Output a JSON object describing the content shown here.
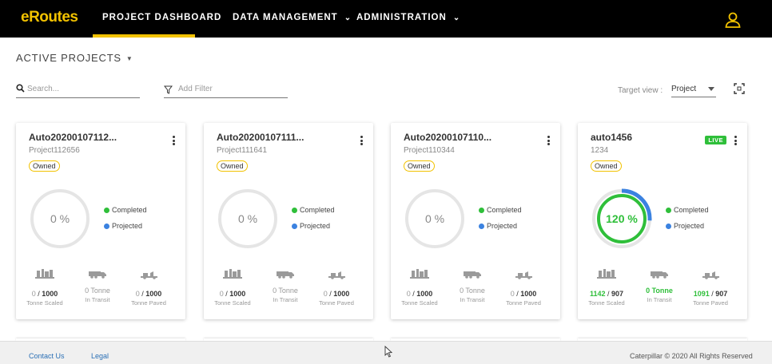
{
  "app": {
    "logo": "eRoutes"
  },
  "nav": {
    "items": [
      {
        "label": "PROJECT DASHBOARD",
        "active": true
      },
      {
        "label": "DATA MANAGEMENT",
        "dropdown": true
      },
      {
        "label": "ADMINISTRATION",
        "dropdown": true
      }
    ],
    "user_icon": "user-icon"
  },
  "toolbar": {
    "section_title": "ACTIVE PROJECTS",
    "search_placeholder": "Search...",
    "filter_placeholder": "Add Filter",
    "target_view_label": "Target view :",
    "target_view_value": "Project"
  },
  "projects": [
    {
      "title": "Auto20200107112...",
      "project_id": "Project112656",
      "owned_label": "Owned",
      "live": false,
      "percent": "0 %",
      "completion": 0,
      "legend_completed": "Completed",
      "legend_projected": "Projected",
      "scaled": {
        "value": "0",
        "total": "1000",
        "caption": "Tonne Scaled"
      },
      "transit": {
        "value": "0 Tonne",
        "caption": "In Transit"
      },
      "paved": {
        "value": "0",
        "total": "1000",
        "caption": "Tonne Paved"
      }
    },
    {
      "title": "Auto20200107111...",
      "project_id": "Project111641",
      "owned_label": "Owned",
      "live": false,
      "percent": "0 %",
      "completion": 0,
      "legend_completed": "Completed",
      "legend_projected": "Projected",
      "scaled": {
        "value": "0",
        "total": "1000",
        "caption": "Tonne Scaled"
      },
      "transit": {
        "value": "0 Tonne",
        "caption": "In Transit"
      },
      "paved": {
        "value": "0",
        "total": "1000",
        "caption": "Tonne Paved"
      }
    },
    {
      "title": "Auto20200107110...",
      "project_id": "Project110344",
      "owned_label": "Owned",
      "live": false,
      "percent": "0 %",
      "completion": 0,
      "legend_completed": "Completed",
      "legend_projected": "Projected",
      "scaled": {
        "value": "0",
        "total": "1000",
        "caption": "Tonne Scaled"
      },
      "transit": {
        "value": "0 Tonne",
        "caption": "In Transit"
      },
      "paved": {
        "value": "0",
        "total": "1000",
        "caption": "Tonne Paved"
      }
    },
    {
      "title": "auto1456",
      "project_id": "1234",
      "owned_label": "Owned",
      "live": true,
      "live_label": "LIVE",
      "percent": "120 %",
      "completion": 1.2,
      "legend_completed": "Completed",
      "legend_projected": "Projected",
      "scaled": {
        "value": "1142",
        "total": "907",
        "caption": "Tonne Scaled"
      },
      "transit": {
        "value": "0 Tonne",
        "caption": "In Transit"
      },
      "paved": {
        "value": "1091",
        "total": "907",
        "caption": "Tonne Paved"
      }
    }
  ],
  "footer": {
    "contact": "Contact Us",
    "legal": "Legal",
    "copyright": "Caterpillar © 2020 All Rights Reserved"
  },
  "colors": {
    "brand_yellow": "#f2c200",
    "completed_green": "#2fbf3a",
    "projected_blue": "#3b82e0",
    "ring_gray": "#e5e5e5"
  }
}
